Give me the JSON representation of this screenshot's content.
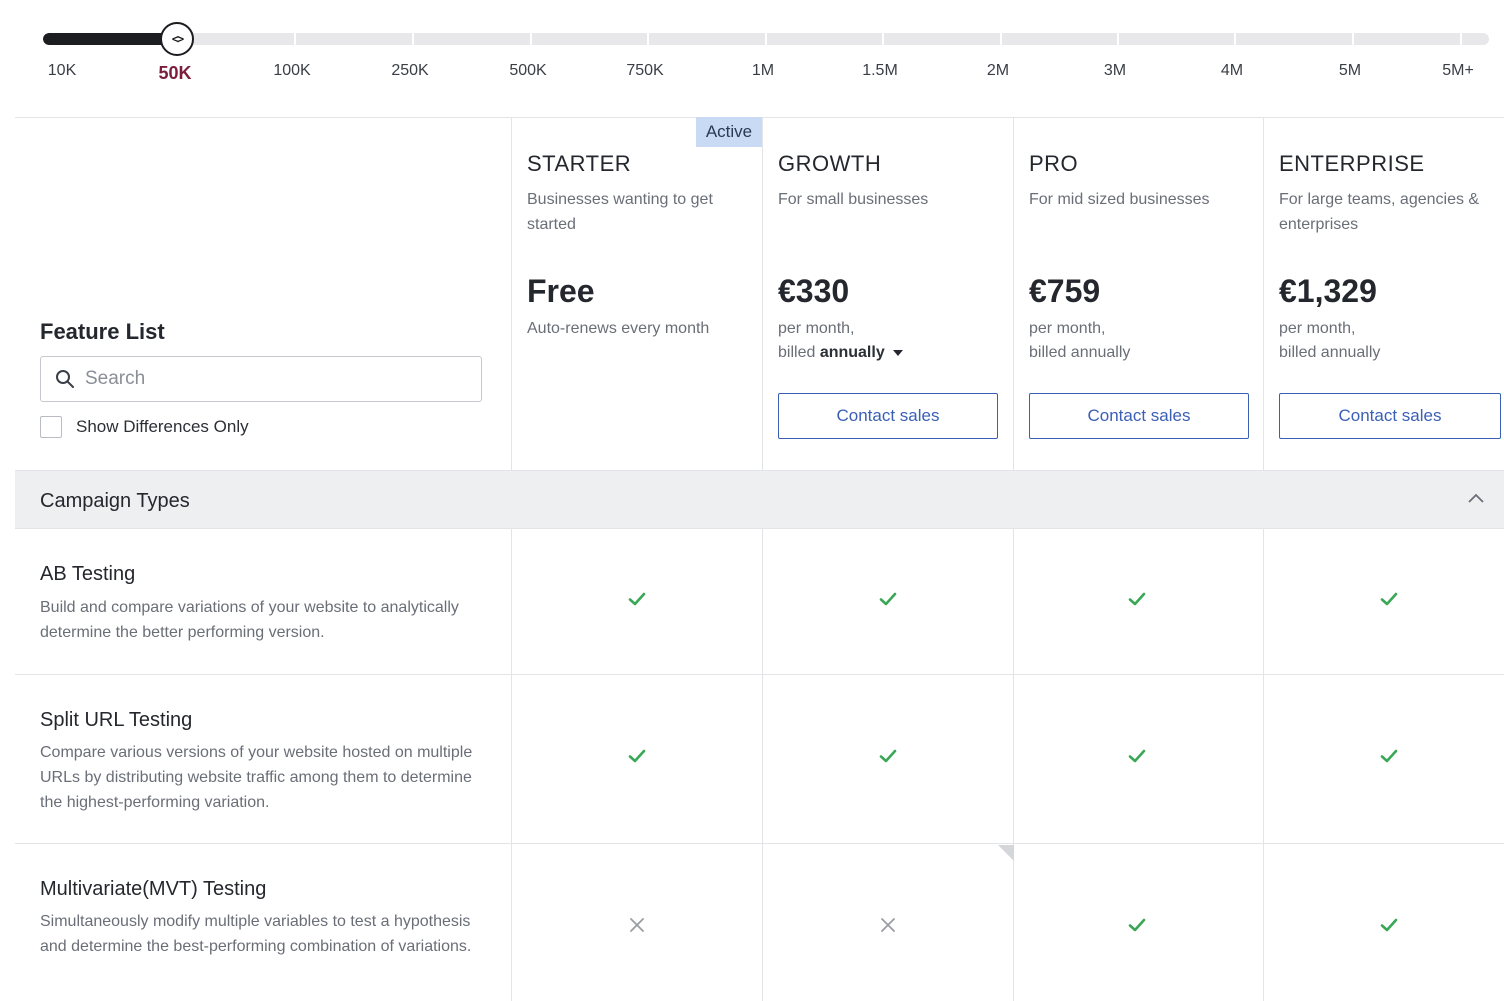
{
  "slider": {
    "thumb_icon": "<>",
    "ticks": [
      "10K",
      "50K",
      "100K",
      "250K",
      "500K",
      "750K",
      "1M",
      "1.5M",
      "2M",
      "3M",
      "4M",
      "5M",
      "5M+"
    ],
    "selected_index": 1,
    "selected_value": "50K"
  },
  "feature_list": {
    "title": "Feature List",
    "search_placeholder": "Search",
    "show_differences_label": "Show Differences Only",
    "show_differences_checked": false
  },
  "active_badge": "Active",
  "plans": [
    {
      "name": "STARTER",
      "description": "Businesses wanting to get started",
      "price": "Free",
      "billing_line1": "Auto-renews every month",
      "billing_line2_prefix": "",
      "billing_line2_strong": "",
      "button": ""
    },
    {
      "name": "GROWTH",
      "description": "For small businesses",
      "price": "€330",
      "billing_line1": "per month,",
      "billing_line2_prefix": "billed ",
      "billing_line2_strong": "annually",
      "button": "Contact sales"
    },
    {
      "name": "PRO",
      "description": "For mid sized businesses",
      "price": "€759",
      "billing_line1": "per month,",
      "billing_line2_prefix": "billed annually",
      "billing_line2_strong": "",
      "button": "Contact sales"
    },
    {
      "name": "ENTERPRISE",
      "description": "For large teams, agencies & enterprises",
      "price": "€1,329",
      "billing_line1": "per month,",
      "billing_line2_prefix": "billed annually",
      "billing_line2_strong": "",
      "button": "Contact sales"
    }
  ],
  "section": {
    "title": "Campaign Types",
    "expanded": true
  },
  "features": [
    {
      "name": "AB Testing",
      "description": "Build and compare variations of your website to analytically determine the better performing version.",
      "availability": [
        true,
        true,
        true,
        true
      ]
    },
    {
      "name": "Split URL Testing",
      "description": "Compare various versions of your website hosted on multiple URLs by distributing website traffic among them to determine the highest-performing variation.",
      "availability": [
        true,
        true,
        true,
        true
      ]
    },
    {
      "name": "Multivariate(MVT) Testing",
      "description": "Simultaneously modify multiple variables to test a hypothesis and determine the best-performing combination of variations.",
      "availability": [
        false,
        false,
        true,
        true
      ]
    }
  ],
  "colors": {
    "check": "#3aa757",
    "cross": "#9a9da3",
    "selected_tick": "#7a1e3c",
    "button": "#3b5fb5",
    "badge_bg": "#c8daf4"
  }
}
